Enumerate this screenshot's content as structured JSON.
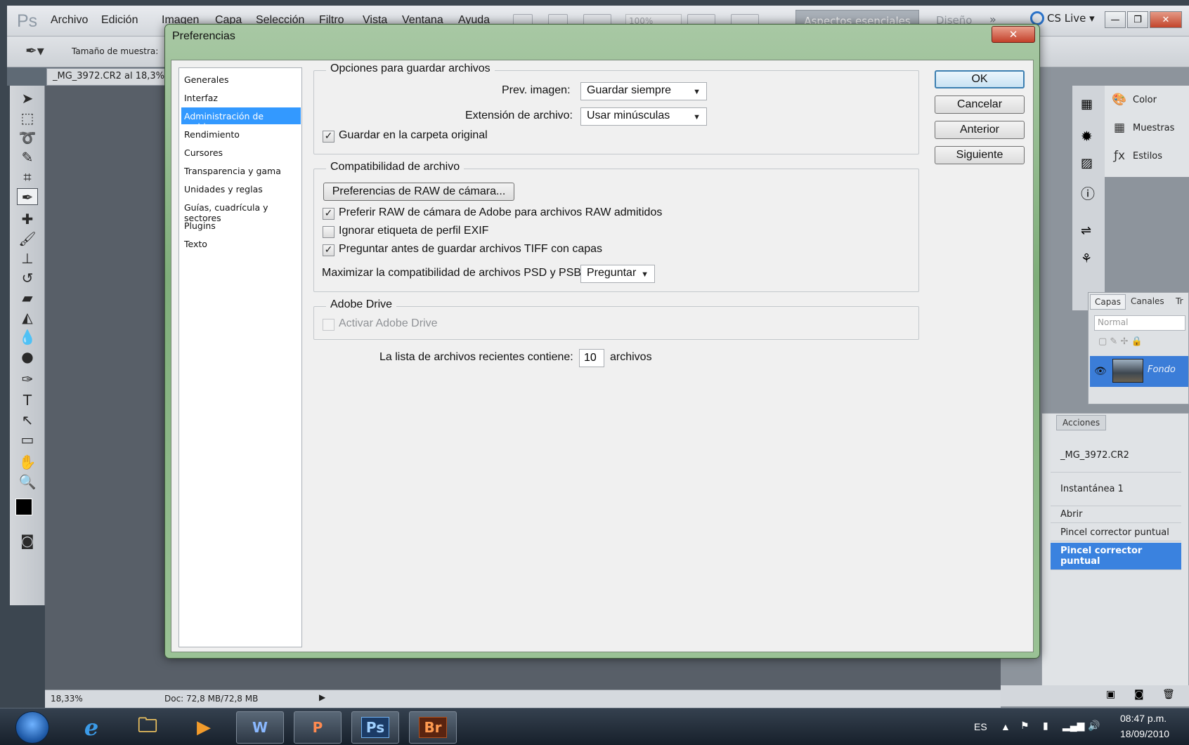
{
  "menubar": {
    "logo": "Ps",
    "items": [
      "Archivo",
      "Edición",
      "Imagen",
      "Capa",
      "Selección",
      "Filtro",
      "Vista",
      "Ventana",
      "Ayuda"
    ],
    "zoom": "100%",
    "workspace_active": "Aspectos esenciales",
    "workspace_other": "Diseño",
    "more": "»",
    "cs_live": "CS Live ▾"
  },
  "optionsbar": {
    "sample_size_label": "Tamaño de muestra:"
  },
  "document": {
    "tab_title": "_MG_3972.CR2 al 18,3%",
    "zoom": "18,33%",
    "doc_info": "Doc: 72,8 MB/72,8 MB"
  },
  "right_panels": {
    "mini": [
      "Color",
      "Muestras",
      "Estilos"
    ],
    "layers_tabs": [
      "Capas",
      "Canales",
      "Tr"
    ],
    "blend_mode": "Normal",
    "layer_name": "Fondo",
    "history_tab": "Acciones",
    "history": [
      "_MG_3972.CR2",
      "Instantánea 1",
      "Abrir",
      "Pincel corrector puntual",
      "Pincel corrector puntual"
    ]
  },
  "dialog": {
    "title": "Preferencias",
    "close": "✕",
    "categories": [
      "Generales",
      "Interfaz",
      "Administración de archivos",
      "Rendimiento",
      "Cursores",
      "Transparencia y gama",
      "Unidades y reglas",
      "Guías, cuadrícula y sectores",
      "Plugins",
      "Texto"
    ],
    "selected_category": 2,
    "save_group": {
      "title": "Opciones para guardar archivos",
      "preview_label": "Prev. imagen:",
      "preview_value": "Guardar siempre",
      "extension_label": "Extensión de archivo:",
      "extension_value": "Usar minúsculas",
      "save_original_label": "Guardar en la carpeta original",
      "save_original_checked": true
    },
    "compat_group": {
      "title": "Compatibilidad de archivo",
      "raw_button": "Preferencias de RAW de cámara...",
      "prefer_raw_label": "Preferir RAW de cámara de Adobe para archivos RAW admitidos",
      "prefer_raw_checked": true,
      "ignore_exif_label": "Ignorar etiqueta de perfil EXIF",
      "ignore_exif_checked": false,
      "ask_tiff_label": "Preguntar antes de guardar archivos TIFF con capas",
      "ask_tiff_checked": true,
      "maximize_label": "Maximizar la compatibilidad de archivos PSD y PSB:",
      "maximize_value": "Preguntar"
    },
    "drive_group": {
      "title": "Adobe Drive",
      "enable_label": "Activar Adobe Drive",
      "enable_checked": false
    },
    "recent": {
      "label": "La lista de archivos recientes contiene:",
      "value": "10",
      "suffix": "archivos"
    },
    "buttons": {
      "ok": "OK",
      "cancel": "Cancelar",
      "prev": "Anterior",
      "next": "Siguiente"
    }
  },
  "taskbar": {
    "apps": [
      "Internet Explorer",
      "Explorador",
      "Media Player",
      "Word",
      "PowerPoint",
      "Ps",
      "Br"
    ],
    "language": "ES",
    "time": "08:47 p.m.",
    "date": "18/09/2010"
  },
  "colors": {
    "dialog_frame": "#8fb98a",
    "selection": "#3399ff",
    "default_button_border": "#3c7fb1",
    "history_selected": "#3a82df"
  }
}
